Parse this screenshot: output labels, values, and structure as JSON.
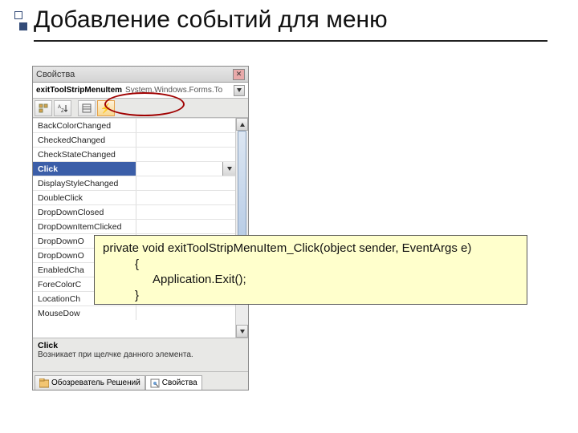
{
  "slide": {
    "title": "Добавление событий для меню"
  },
  "properties": {
    "window_title": "Свойства",
    "object_name": "exitToolStripMenuItem",
    "object_type": "System.Windows.Forms.To",
    "events": [
      "BackColorChanged",
      "CheckedChanged",
      "CheckStateChanged",
      "Click",
      "DisplayStyleChanged",
      "DoubleClick",
      "DropDownClosed",
      "DropDownItemClicked",
      "DropDownO",
      "DropDownO",
      "EnabledCha",
      "ForeColorC",
      "LocationCh",
      "MouseDow"
    ],
    "selected_index": 3,
    "description": {
      "title": "Click",
      "text": "Возникает при щелчке данного элемента."
    }
  },
  "tabs": {
    "left": "Обозреватель Решений",
    "right": "Свойства"
  },
  "code": {
    "line1": "private void exitToolStripMenuItem_Click(object sender, EventArgs e)",
    "line2": "{",
    "line3": "Application.Exit();",
    "line4": "}"
  }
}
